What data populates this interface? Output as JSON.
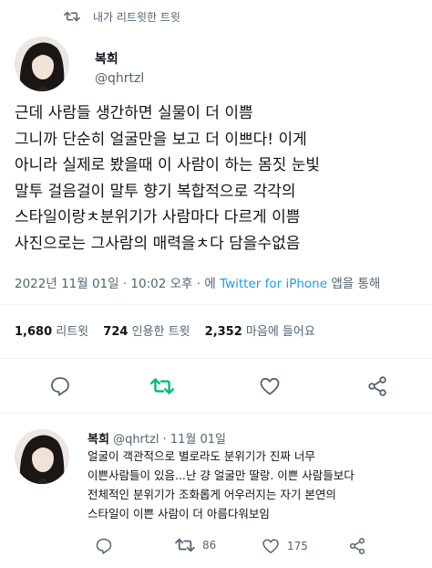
{
  "retweet_header": {
    "text": "내가 리트윗한 트윗"
  },
  "main_tweet": {
    "name": "복희",
    "handle": "@qhrtzl",
    "body_lines": [
      "근데 사람들 생간하면 실물이 더 이쁨",
      "그니까 단순히 얼굴만을 보고 더 이쁘다! 이게",
      "아니라 실제로 봤을때 이 사람이 하는 몸짓 눈빛",
      "말투 걸음걸이 말투 향기 복합적으로 각각의",
      "스타일이랑ㅊ분위기가 사람마다 다르게 이쁨",
      "사진으로는 그사람의 매력을ㅊ다 담을수없음"
    ],
    "date": "2022년 11월 01일 · 10:02 오후 · 에 ",
    "source": "Twitter for iPhone",
    "source_suffix": " 앱을 통해"
  },
  "stats": {
    "retweets": "1,680",
    "retweets_label": "리트윗",
    "quotes": "724",
    "quotes_label": "인용한 트윗",
    "likes": "2,352",
    "likes_label": "마음에 들어요"
  },
  "actions": {
    "reply_icon": "reply-icon",
    "retweet_icon": "retweet-icon",
    "like_icon": "heart-icon",
    "share_icon": "share-icon"
  },
  "reply_tweet": {
    "name": "복희",
    "handle": "@qhrtzl",
    "separator": "·",
    "date": "11월 01일",
    "body_lines": [
      "얼굴이 객관적으로 별로라도 분위기가 진짜 너무",
      "이쁜사람들이 있음...난 걍 얼굴만 딸랑. 이쁜 사람들보다",
      "전체적인 분위기가 조화롭게 어우러지는 자기 본연의",
      "스타일이 이쁜 사람이 더 아름다워보임"
    ],
    "retweet_count": "86",
    "like_count": "175"
  },
  "colors": {
    "accent": "#1d9bf0",
    "retweet_green": "#00ba7c",
    "secondary": "#536471"
  }
}
